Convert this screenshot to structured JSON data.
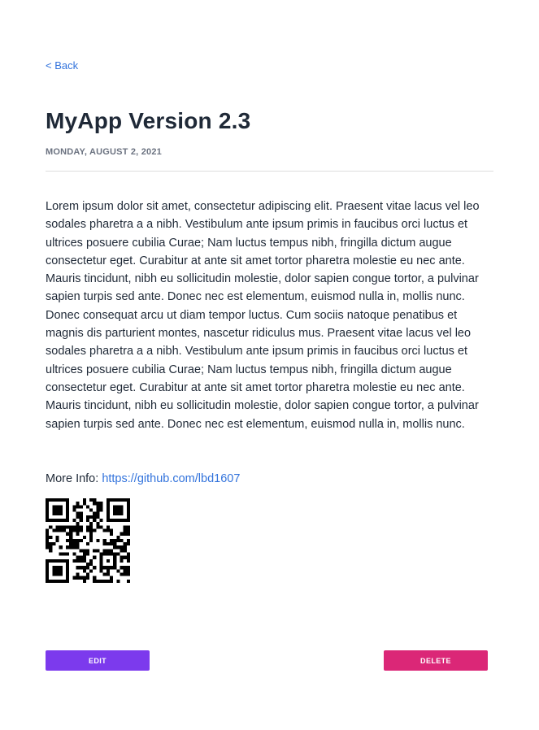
{
  "nav": {
    "back_label": "< Back"
  },
  "post": {
    "title": "MyApp Version 2.3",
    "date": "MONDAY, AUGUST 2, 2021",
    "body": "Lorem ipsum dolor sit amet, consectetur adipiscing elit. Praesent vitae lacus vel leo sodales pharetra a a nibh. Vestibulum ante ipsum primis in faucibus orci luctus et ultrices posuere cubilia Curae; Nam luctus tempus nibh, fringilla dictum augue consectetur eget. Curabitur at ante sit amet tortor pharetra molestie eu nec ante. Mauris tincidunt, nibh eu sollicitudin molestie, dolor sapien congue tortor, a pulvinar sapien turpis sed ante. Donec nec est elementum, euismod nulla in, mollis nunc. Donec consequat arcu ut diam tempor luctus. Cum sociis natoque penatibus et magnis dis parturient montes, nascetur ridiculus mus. Praesent vitae lacus vel leo sodales pharetra a a nibh. Vestibulum ante ipsum primis in faucibus orci luctus et ultrices posuere cubilia Curae; Nam luctus tempus nibh, fringilla dictum augue consectetur eget. Curabitur at ante sit amet tortor pharetra molestie eu nec ante. Mauris tincidunt, nibh eu sollicitudin molestie, dolor sapien congue tortor, a pulvinar sapien turpis sed ante. Donec nec est elementum, euismod nulla in, mollis nunc.",
    "more_info_label": "More Info:",
    "more_info_url": "https://github.com/lbd1607"
  },
  "actions": {
    "edit_label": "EDIT",
    "delete_label": "DELETE"
  },
  "colors": {
    "link": "#3273dc",
    "edit": "#7c3aed",
    "delete": "#db2777"
  },
  "icons": {
    "qr": "qr-code-icon"
  }
}
